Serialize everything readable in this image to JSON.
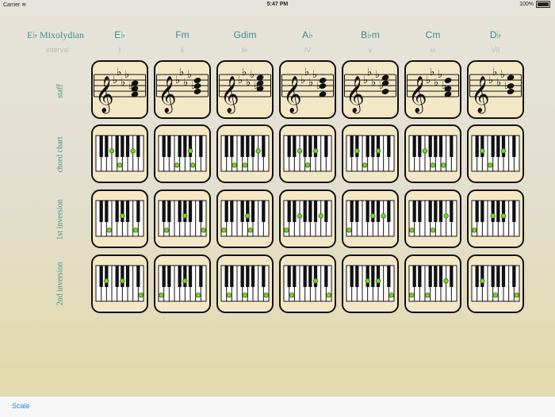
{
  "status_bar": {
    "carrier": "Carrier",
    "time": "5:47 PM",
    "battery": "100%"
  },
  "header": {
    "scale_name": "E♭ Mixolydian",
    "interval_label": "interval"
  },
  "chords": [
    {
      "name": "E♭",
      "roman": "I"
    },
    {
      "name": "Fm",
      "roman": "ii"
    },
    {
      "name": "Gdim",
      "roman": "iii◦"
    },
    {
      "name": "A♭",
      "roman": "IV"
    },
    {
      "name": "B♭m",
      "roman": "v"
    },
    {
      "name": "Cm",
      "roman": "vi"
    },
    {
      "name": "D♭",
      "roman": "VII"
    }
  ],
  "rows": {
    "staff": "staff",
    "chord_chart": "chord chart",
    "first_inversion": "1st inversion",
    "second_inversion": "2nd inversion"
  },
  "bottom_bar": {
    "scale_button": "Scale"
  },
  "colors": {
    "accent": "#3a8f8a",
    "card": "#f4e7c5",
    "dot": "#7ed321",
    "link": "#1f7fd1"
  },
  "icons": {
    "clef": "treble-clef-icon",
    "flat": "flat-icon",
    "wifi": "wifi-icon",
    "battery": "battery-icon"
  }
}
